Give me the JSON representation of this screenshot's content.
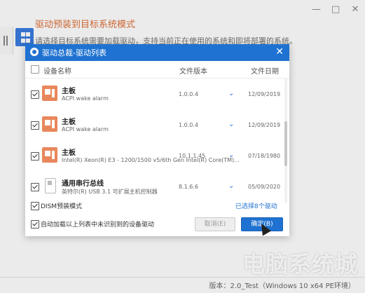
{
  "background": {
    "title": "驱动预装到目标系统模式",
    "subtitle": "请选择目标系统需要加载驱动，支持当前正在使用的系统和即将部署的系统。",
    "footer_text": "版本：2.0_Test（Windows 10 x64 PE环境）",
    "watermark": "电脑系统城",
    "window_controls": {
      "minimize": "—",
      "maximize": "□",
      "close": "✕"
    }
  },
  "dialog": {
    "title": "驱动总裁-驱动列表",
    "close_label": "✕",
    "columns": {
      "name": "设备名称",
      "version": "文件版本",
      "date": "文件日期"
    },
    "rows": [
      {
        "name": "主板",
        "desc": "ACPI wake alarm",
        "version": "1.0.0.4",
        "date": "12/09/2019",
        "chevron": "⌄"
      },
      {
        "name": "主板",
        "desc": "ACPI wake alarm",
        "version": "1.0.0.4",
        "date": "12/09/2019",
        "chevron": "⌄"
      },
      {
        "name": "主板",
        "desc": "Intel(R) Xeon(R) E3 - 1200/1500 v5/6th Gen Intel(R) Core(TM)...",
        "version": "10.1.1.45",
        "date": "07/18/1980",
        "chevron": "⌄"
      },
      {
        "name": "通用串行总线",
        "desc": "英特尔(R) USB 3.1 可扩展主机控制器",
        "version": "8.1.6.6",
        "date": "05/09/2020",
        "chevron": "⌄"
      }
    ],
    "dism_label": "DISM预装模式",
    "selected_count": "已选择8个驱动",
    "auto_load_label": "自动加载以上列表中未识别到的设备驱动",
    "cancel_label": "取消(E)",
    "ok_label": "确定(B)"
  },
  "colors": {
    "accent": "#1f72d1",
    "title_orange": "#e0703a",
    "device_icon": "#e8875c"
  }
}
